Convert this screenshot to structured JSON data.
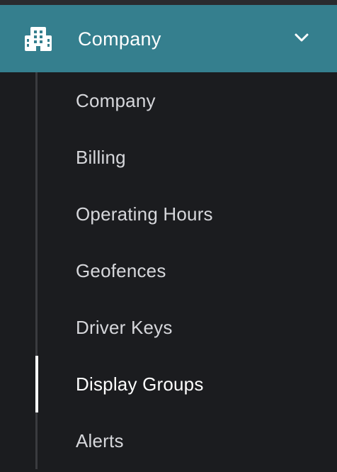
{
  "header": {
    "icon": "building-icon",
    "label": "Company",
    "chevron_icon": "chevron-down-icon",
    "expanded": true,
    "background": "#357f8e"
  },
  "submenu": {
    "active_index": 5,
    "items": [
      {
        "label": "Company"
      },
      {
        "label": "Billing"
      },
      {
        "label": "Operating Hours"
      },
      {
        "label": "Geofences"
      },
      {
        "label": "Driver Keys"
      },
      {
        "label": "Display Groups"
      },
      {
        "label": "Alerts"
      }
    ]
  },
  "colors": {
    "sidebar_bg": "#1b1c1f",
    "text": "#d6d7db",
    "active_text": "#ffffff",
    "active_indicator": "#ffffff"
  }
}
